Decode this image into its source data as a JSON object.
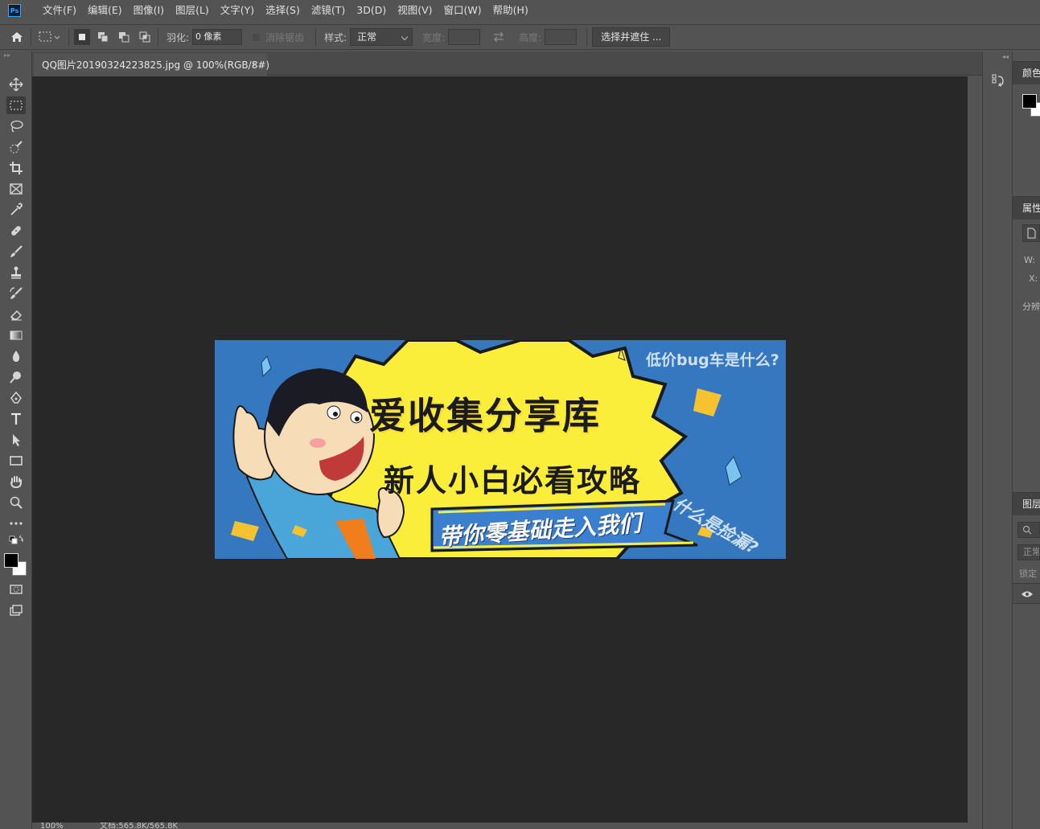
{
  "app": {
    "logo_text": "Ps"
  },
  "menu": {
    "items": [
      "文件(F)",
      "编辑(E)",
      "图像(I)",
      "图层(L)",
      "文字(Y)",
      "选择(S)",
      "滤镜(T)",
      "3D(D)",
      "视图(V)",
      "窗口(W)",
      "帮助(H)"
    ]
  },
  "options": {
    "feather_label": "羽化:",
    "feather_value": "0 像素",
    "antialias_label": "消除锯齿",
    "style_label": "样式:",
    "style_value": "正常",
    "width_label": "宽度:",
    "height_label": "高度:",
    "select_mask_button": "选择并遮住 ..."
  },
  "document": {
    "tab_title": "QQ图片20190324223825.jpg @ 100%(RGB/8#)",
    "close_glyph": "×",
    "zoom": "100%",
    "doc_info": "文档:565.8K/565.8K"
  },
  "banner": {
    "title": "爱收集分享库",
    "subtitle": "新人小白必看攻略",
    "ribbon": "带你零基础走入我们",
    "top_right": "低价bug车是什么?",
    "side": "什么是捡漏?"
  },
  "panels": {
    "color_tab": "颜色",
    "properties_tab": "属性",
    "w_label": "W:",
    "x_label": "X:",
    "resolution_label": "分辨",
    "layers_tab": "图层",
    "layer_mode": "正常",
    "lock_label": "锁定"
  },
  "colors": {
    "background": "#535353",
    "canvas": "#282828",
    "banner_blue": "#3578c0",
    "banner_yellow": "#fbee3b"
  }
}
